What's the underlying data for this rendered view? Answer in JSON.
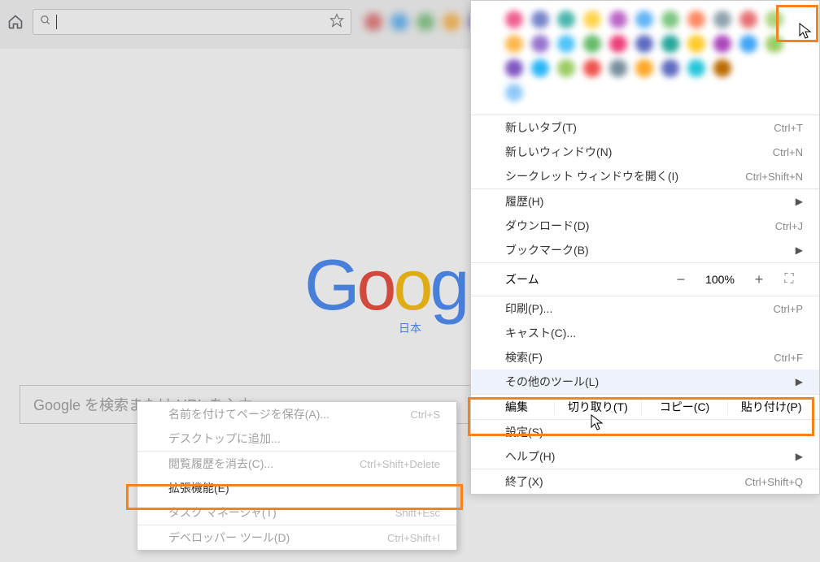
{
  "toolbar": {
    "placeholder": ""
  },
  "page": {
    "logo": "Google",
    "japan": "日本",
    "search_placeholder": "Google を検索または URL を入力"
  },
  "mainMenu": {
    "new_tab": "新しいタブ(T)",
    "new_tab_sc": "Ctrl+T",
    "new_window": "新しいウィンドウ(N)",
    "new_window_sc": "Ctrl+N",
    "incognito": "シークレット ウィンドウを開く(I)",
    "incognito_sc": "Ctrl+Shift+N",
    "history": "履歴(H)",
    "downloads": "ダウンロード(D)",
    "downloads_sc": "Ctrl+J",
    "bookmarks": "ブックマーク(B)",
    "zoom": "ズーム",
    "zoom_val": "100%",
    "print": "印刷(P)...",
    "print_sc": "Ctrl+P",
    "cast": "キャスト(C)...",
    "find": "検索(F)",
    "find_sc": "Ctrl+F",
    "more_tools": "その他のツール(L)",
    "edit": "編集",
    "cut": "切り取り(T)",
    "copy": "コピー(C)",
    "paste": "貼り付け(P)",
    "settings": "設定(S)",
    "help": "ヘルプ(H)",
    "exit": "終了(X)",
    "exit_sc": "Ctrl+Shift+Q"
  },
  "subMenu": {
    "save_as": "名前を付けてページを保存(A)...",
    "save_as_sc": "Ctrl+S",
    "add_desktop": "デスクトップに追加...",
    "clear_history": "閲覧履歴を消去(C)...",
    "clear_history_sc": "Ctrl+Shift+Delete",
    "extensions": "拡張機能(E)",
    "task_mgr": "タスク マネージャ(T)",
    "task_mgr_sc": "Shift+Esc",
    "dev_tools": "デベロッパー ツール(D)",
    "dev_tools_sc": "Ctrl+Shift+I"
  },
  "ext_colors_top": [
    "#e57373",
    "#64b5f6",
    "#81c784",
    "#ffb74d",
    "#9575cd",
    "#4fc3f7",
    "#aed581",
    "#f06292",
    "#7986cb",
    "#ffd54f",
    "#4db6ac",
    "#ff8a65",
    "#ba68c8",
    "#90a4ae"
  ],
  "ext_colors_menu": [
    [
      "#f06292",
      "#7986cb",
      "#4db6ac",
      "#ffd54f",
      "#ba68c8",
      "#64b5f6",
      "#81c784",
      "#ff8a65",
      "#90a4ae",
      "#e57373",
      "#aed581"
    ],
    [
      "#ffb74d",
      "#9575cd",
      "#4fc3f7",
      "#66bb6a",
      "#ec407a",
      "#5c6bc0",
      "#26a69a",
      "#ffca28",
      "#ab47bc",
      "#42a5f5",
      "#9ccc65"
    ],
    [
      "#7e57c2",
      "#29b6f6",
      "#9ccc65",
      "#ef5350",
      "#78909c",
      "#ffa726",
      "#5c6bc0",
      "#26c6da",
      "#bb6b00"
    ],
    [
      "#90caf9"
    ]
  ]
}
